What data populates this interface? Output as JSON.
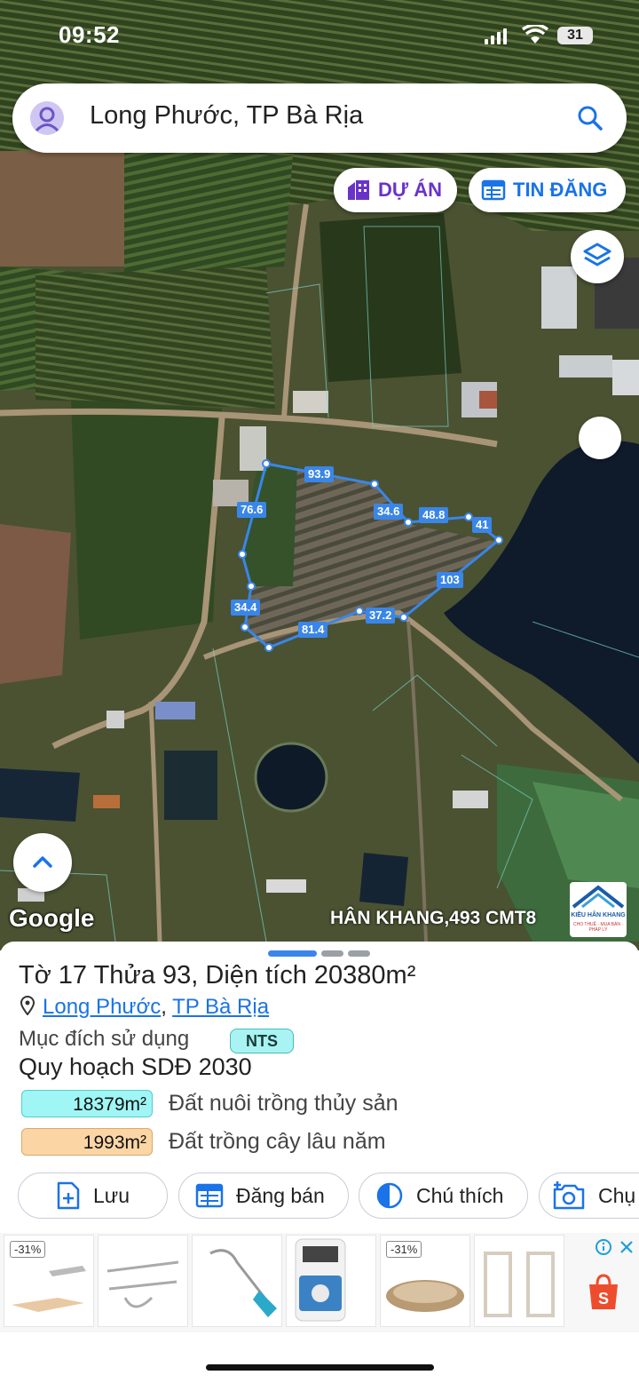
{
  "status": {
    "time": "09:52",
    "battery": "31"
  },
  "search": {
    "text": "Long Phước, TP Bà Rịa"
  },
  "buttons": {
    "du_an": "DỰ ÁN",
    "tin_dang": "TIN ĐĂNG"
  },
  "map": {
    "attribution": "Google",
    "watermark": "HÂN KHANG,493 CMT8",
    "logo_text": "KIỀU HÂN KHANG",
    "logo_subtext": "CHO THUÊ · MUA BÁN · PHÁP LÝ",
    "parcel_lengths": [
      "93.9",
      "76.6",
      "34.6",
      "48.8",
      "41",
      "103",
      "37.2",
      "81.4",
      "34.4"
    ],
    "boundary_color": "#3a86e8"
  },
  "parcel": {
    "title": "Tờ 17 Thửa 93, Diện tích 20380m²",
    "ward": "Long Phước",
    "separator": ",",
    "city": "TP Bà Rịa",
    "purpose_label": "Mục đích sử dụng",
    "purpose_code": "NTS",
    "plan_title": "Quy hoạch SDĐ 2030",
    "plan_items": [
      {
        "area": "18379m²",
        "label": "Đất nuôi trồng thủy sản",
        "color": "#9ff6f5"
      },
      {
        "area": "1993m²",
        "label": "Đất trồng cây lâu năm",
        "color": "#fcd5a5"
      }
    ]
  },
  "actions": {
    "save": "Lưu",
    "post": "Đăng bán",
    "legend": "Chú thích",
    "capture": "Chụ"
  },
  "ads": {
    "discount1": "-31%",
    "discount2": "-31%"
  }
}
